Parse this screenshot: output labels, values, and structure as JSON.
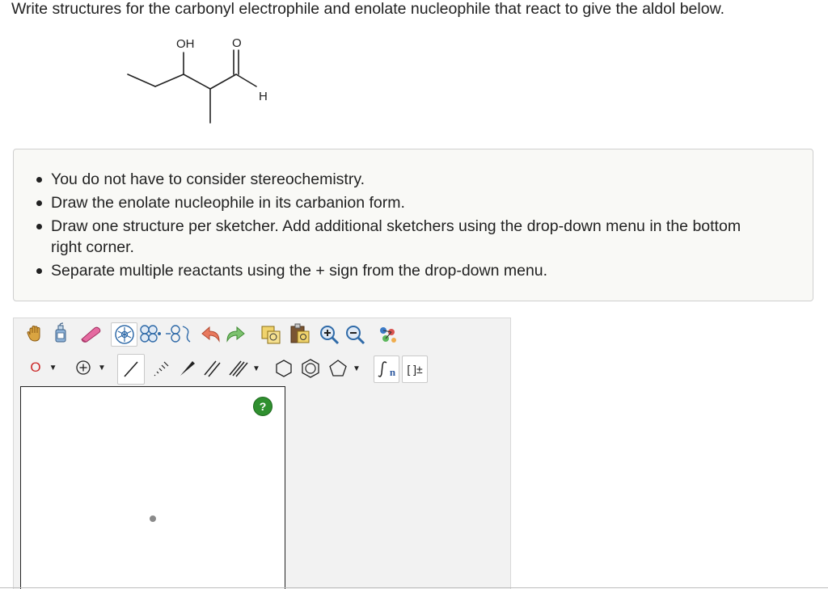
{
  "question": {
    "text": "Write structures for the carbonyl electrophile and enolate nucleophile that react to give the aldol below."
  },
  "molecule": {
    "oh_label": "OH",
    "o_label": "O",
    "h_label": "H"
  },
  "instructions": {
    "items": [
      "You do not have to consider stereochemistry.",
      "Draw the enolate nucleophile in its carbanion form.",
      "Draw one structure per sketcher. Add additional sketchers using the drop-down menu in the bottom right corner.",
      "Separate multiple reactants using the + sign from the drop-down menu."
    ]
  },
  "toolbar": {
    "atom_label": "O",
    "help_label": "?",
    "sgroup_label": "n",
    "bracket_label": "[ ]±"
  },
  "colors": {
    "accent_red": "#cc2a2a",
    "help_green": "#2f8f2f",
    "panel_bg": "#f2f2f2",
    "info_bg": "#f9f9f6"
  }
}
